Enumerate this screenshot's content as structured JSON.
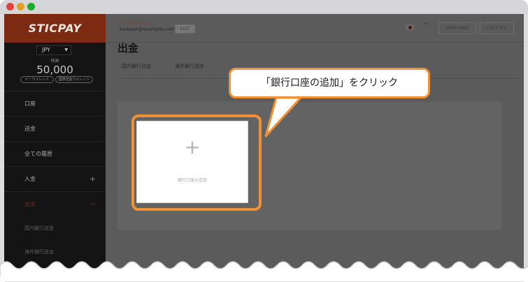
{
  "window": {
    "traffic_lights": {
      "close_color": "#e0443e",
      "minimize_color": "#dea123",
      "maximize_color": "#1aab29"
    }
  },
  "brand": {
    "logo": "STICPAY",
    "accent_color": "#7d2a12"
  },
  "sidebar": {
    "currency": "JPY",
    "balance_label": "残高",
    "balance": "50,000",
    "wallet_buttons": [
      "イーウォレット",
      "国際送金ウォレット"
    ],
    "items": [
      {
        "label": "口座"
      },
      {
        "label": "送金"
      },
      {
        "label": "全ての履歴"
      },
      {
        "label": "入金",
        "expander": "+"
      },
      {
        "label": "出金",
        "expander": "−",
        "active": true
      }
    ],
    "sub_items": [
      "国内銀行送金",
      "海外銀行送金"
    ]
  },
  "header": {
    "user_name": "Taro Kawase",
    "user_email": "kawase@example.com",
    "edit_label": "EDIT",
    "main_page_label": "MAIN PAGE",
    "logout_label": "ログアウト"
  },
  "page": {
    "title": "出金",
    "tabs": [
      "国内銀行送金",
      "海外銀行送金"
    ]
  },
  "add_bank": {
    "plus": "+",
    "label": "銀行口座の追加"
  },
  "callout": {
    "text": "「銀行口座の追加」をクリック",
    "color": "#ef9235"
  }
}
